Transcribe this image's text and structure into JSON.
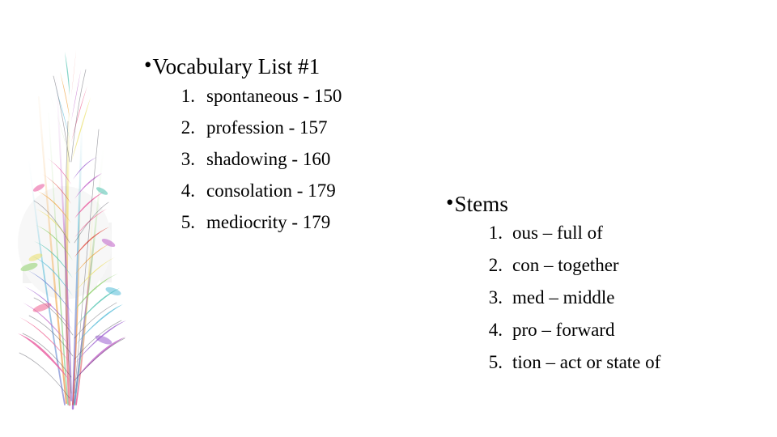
{
  "slide": {
    "background_color": "#ffffff",
    "text_color": "#000000"
  },
  "artwork": {
    "name": "abstract-feather-grass-decoration",
    "description": "Abstract pastel rainbow feather and grass-blade spray",
    "palette": [
      "#e8559c",
      "#f06292",
      "#e0483c",
      "#f0a13c",
      "#ece06a",
      "#e8e86a",
      "#8ed06a",
      "#4fc3b0",
      "#56bcd8",
      "#6a7fd4",
      "#9c5fd0",
      "#c060c8",
      "#d8d8d8"
    ]
  },
  "vocabulary": {
    "heading_bullet": "•",
    "heading": "Vocabulary List #1",
    "items": [
      {
        "number": "1.",
        "label": "spontaneous - 150"
      },
      {
        "number": "2.",
        "label": "profession - 157"
      },
      {
        "number": "3.",
        "label": "shadowing - 160"
      },
      {
        "number": "4.",
        "label": "consolation - 179"
      },
      {
        "number": "5.",
        "label": "mediocrity - 179"
      }
    ]
  },
  "stems": {
    "heading_bullet": "•",
    "heading": "Stems",
    "items": [
      {
        "number": "1.",
        "label": "ous – full of"
      },
      {
        "number": "2.",
        "label": "con – together"
      },
      {
        "number": "3.",
        "label": "med – middle"
      },
      {
        "number": "4.",
        "label": "pro – forward"
      },
      {
        "number": "5.",
        "label": "tion – act or state of"
      }
    ]
  }
}
